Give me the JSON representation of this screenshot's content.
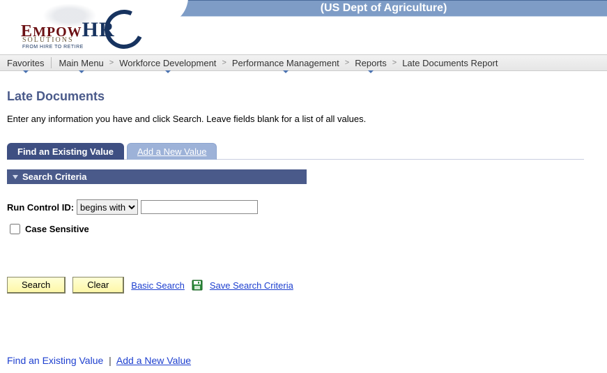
{
  "header": {
    "org_title": "(US Dept of Agriculture)",
    "logo_main_1": "E",
    "logo_main_2": "MPOW",
    "logo_main_3": "HR",
    "logo_sub": "SOLUTIONS",
    "logo_tag": "FROM HIRE TO RETIRE"
  },
  "breadcrumb": {
    "favorites": "Favorites",
    "main_menu": "Main Menu",
    "items": [
      "Workforce Development",
      "Performance Management",
      "Reports",
      "Late Documents Report"
    ]
  },
  "page": {
    "title": "Late Documents",
    "instructions": "Enter any information you have and click Search. Leave fields blank for a list of all values."
  },
  "tabs": {
    "find": "Find an Existing Value",
    "add": "Add a New Value"
  },
  "criteria": {
    "header": "Search Criteria",
    "run_control_label": "Run Control ID:",
    "operator_value": "begins with",
    "run_control_value": "",
    "case_sensitive_label": "Case Sensitive"
  },
  "buttons": {
    "search": "Search",
    "clear": "Clear",
    "basic_search": "Basic Search",
    "save_criteria": "Save Search Criteria"
  },
  "bottom": {
    "find": "Find an Existing Value",
    "add": "Add a New Value"
  }
}
